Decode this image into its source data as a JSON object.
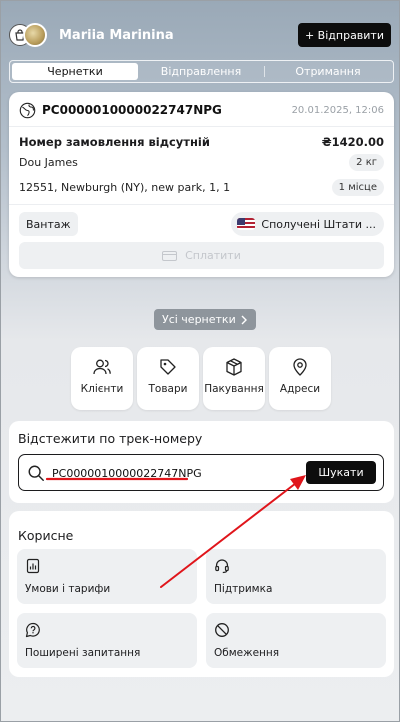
{
  "header": {
    "avatar_icon": "shopping-bag-icon",
    "user_name": "Mariia Marinina",
    "send_label": "+ Відправити"
  },
  "tabs": [
    {
      "label": "Чернетки",
      "active": true
    },
    {
      "label": "Відправлення",
      "active": false
    },
    {
      "label": "Отримання",
      "active": false
    }
  ],
  "draft": {
    "track_id": "PC0000010000022747NPG",
    "date": "20.01.2025, 12:06",
    "order_status": "Номер замовлення відсутній",
    "price": "₴1420.00",
    "recipient": "Dou James",
    "weight": "2 кг",
    "address": "12551, Newburgh (NY), new park, 1, 1",
    "places": "1 місце",
    "cargo_type": "Вантаж",
    "country": "Сполучені Штати ...",
    "pay_label": "Сплатити"
  },
  "all_drafts_label": "Усі чернетки",
  "quick_actions": [
    {
      "label": "Клієнти",
      "icon": "users-icon"
    },
    {
      "label": "Товари",
      "icon": "tag-icon"
    },
    {
      "label": "Пакування",
      "icon": "box-icon"
    },
    {
      "label": "Адреси",
      "icon": "map-pin-icon"
    }
  ],
  "tracking": {
    "title": "Відстежити по трек-номеру",
    "value": "PC0000010000022747NPG",
    "search_label": "Шукати"
  },
  "useful": {
    "title": "Корисне",
    "items": [
      {
        "label": "Умови і тарифи",
        "icon": "chart-document-icon"
      },
      {
        "label": "Підтримка",
        "icon": "headset-icon"
      },
      {
        "label": "Поширені запитання",
        "icon": "help-bubble-icon"
      },
      {
        "label": "Обмеження",
        "icon": "prohibited-icon"
      }
    ]
  },
  "colors": {
    "accent": "#0d0d0d",
    "annotation": "#e0151b"
  }
}
